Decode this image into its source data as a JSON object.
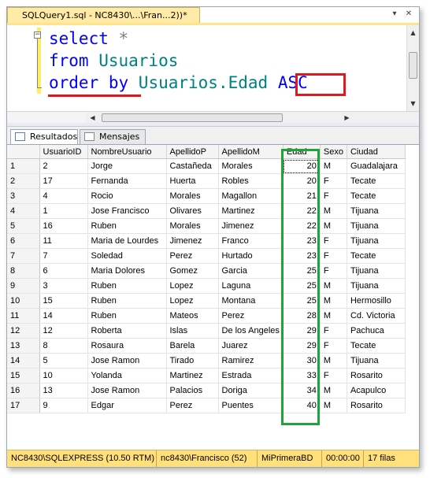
{
  "document_tab": {
    "title": "SQLQuery1.sql - NC8430\\...\\Fran...2))*"
  },
  "window_controls": {
    "pin_glyph": "▾",
    "close_glyph": "✕"
  },
  "editor": {
    "lines": [
      {
        "keyword": "select",
        "rest": " *"
      },
      {
        "keyword": "from",
        "rest": " Usuarios"
      },
      {
        "keyword": "order by",
        "rest": " Usuarios.Edad ",
        "keyword2": "ASC"
      }
    ]
  },
  "results_tabs": [
    {
      "label": "Resultados",
      "active": true
    },
    {
      "label": "Mensajes",
      "active": false
    }
  ],
  "grid": {
    "columns": [
      "UsuarioID",
      "NombreUsuario",
      "ApellidoP",
      "ApellidoM",
      "Edad",
      "Sexo",
      "Ciudad"
    ],
    "rows": [
      [
        "1",
        "2",
        "Jorge",
        "Castañeda",
        "Morales",
        "20",
        "M",
        "Guadalajara"
      ],
      [
        "2",
        "17",
        "Fernanda",
        "Huerta",
        "Robles",
        "20",
        "F",
        "Tecate"
      ],
      [
        "3",
        "4",
        "Rocio",
        "Morales",
        "Magallon",
        "21",
        "F",
        "Tecate"
      ],
      [
        "4",
        "1",
        "Jose Francisco",
        "Olivares",
        "Martinez",
        "22",
        "M",
        "Tijuana"
      ],
      [
        "5",
        "16",
        "Ruben",
        "Morales",
        "Jimenez",
        "22",
        "M",
        "Tijuana"
      ],
      [
        "6",
        "11",
        "Maria de Lourdes",
        "Jimenez",
        "Franco",
        "23",
        "F",
        "Tijuana"
      ],
      [
        "7",
        "7",
        "Soledad",
        "Perez",
        "Hurtado",
        "23",
        "F",
        "Tecate"
      ],
      [
        "8",
        "6",
        "Maria Dolores",
        "Gomez",
        "Garcia",
        "25",
        "F",
        "Tijuana"
      ],
      [
        "9",
        "3",
        "Ruben",
        "Lopez",
        "Laguna",
        "25",
        "M",
        "Tijuana"
      ],
      [
        "10",
        "15",
        "Ruben",
        "Lopez",
        "Montana",
        "25",
        "M",
        "Hermosillo"
      ],
      [
        "11",
        "14",
        "Ruben",
        "Mateos",
        "Perez",
        "28",
        "M",
        "Cd. Victoria"
      ],
      [
        "12",
        "12",
        "Roberta",
        "Islas",
        "De los Angeles",
        "29",
        "F",
        "Pachuca"
      ],
      [
        "13",
        "8",
        "Rosaura",
        "Barela",
        "Juarez",
        "29",
        "F",
        "Tecate"
      ],
      [
        "14",
        "5",
        "Jose Ramon",
        "Tirado",
        "Ramirez",
        "30",
        "M",
        "Tijuana"
      ],
      [
        "15",
        "10",
        "Yolanda",
        "Martinez",
        "Estrada",
        "33",
        "F",
        "Rosarito"
      ],
      [
        "16",
        "13",
        "Jose Ramon",
        "Palacios",
        "Doriga",
        "34",
        "M",
        "Acapulco"
      ],
      [
        "17",
        "9",
        "Edgar",
        "Perez",
        "Puentes",
        "40",
        "M",
        "Rosarito"
      ]
    ]
  },
  "status_bar": {
    "server": "NC8430\\SQLEXPRESS (10.50 RTM)",
    "user": "nc8430\\Francisco (52)",
    "database": "MiPrimeraBD",
    "elapsed": "00:00:00",
    "rows": "17 filas"
  },
  "colors": {
    "keyword": "#0000ff",
    "identifier": "#008080",
    "tab_active": "#ffeaa6",
    "status_bar": "#ffe07a",
    "annotation_red": "#e0191f",
    "annotation_green": "#1ea53a"
  },
  "icons": [
    "results-grid-icon",
    "messages-icon",
    "collapse-minus-icon",
    "close-icon",
    "dropdown-icon"
  ]
}
